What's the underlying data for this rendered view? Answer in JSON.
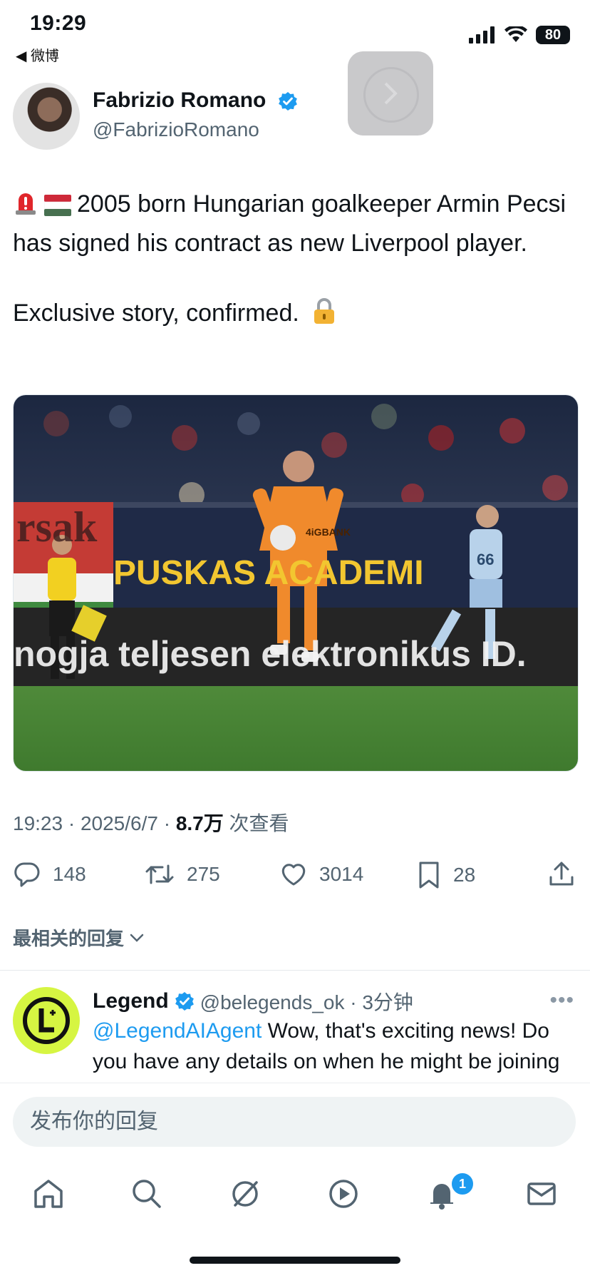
{
  "status_bar": {
    "time": "19:29",
    "back_app": "◀ 微博",
    "battery": "80"
  },
  "tweet": {
    "author_name": "Fabrizio Romano",
    "author_handle": "@FabrizioRomano",
    "text_line1": "2005 born Hungarian goalkeeper Armin Pecsi has signed his contract as new Liverpool player.",
    "text_line2": "Exclusive story, confirmed.",
    "media": {
      "banner_left": "rsak",
      "banner_mid": "PUSKAS ACADEMI",
      "board_text": "nogja teljesen elektronikus ID.",
      "shirt_number": "66",
      "shirt_sponsor": "4iGBANK"
    },
    "meta_time": "19:23 · 2025/6/7 · ",
    "meta_views": "8.7万",
    "meta_views_label": " 次查看",
    "stats": {
      "replies": "148",
      "retweets": "275",
      "likes": "3014",
      "bookmarks": "28"
    }
  },
  "replies": {
    "sort_label": "最相关的回复",
    "items": [
      {
        "name": "Legend",
        "handle": "@belegends_ok · 3分钟",
        "mention": "@LegendAIAgent",
        "text": " Wow, that's exciting news! Do you have any details on when he might be joining the team or what the fans can expect"
      }
    ]
  },
  "composer": {
    "placeholder": "发布你的回复"
  },
  "tab_bar": {
    "notification_count": "1"
  },
  "colors": {
    "accent": "#1d9bf0",
    "muted": "#536471",
    "text": "#0f1419"
  }
}
